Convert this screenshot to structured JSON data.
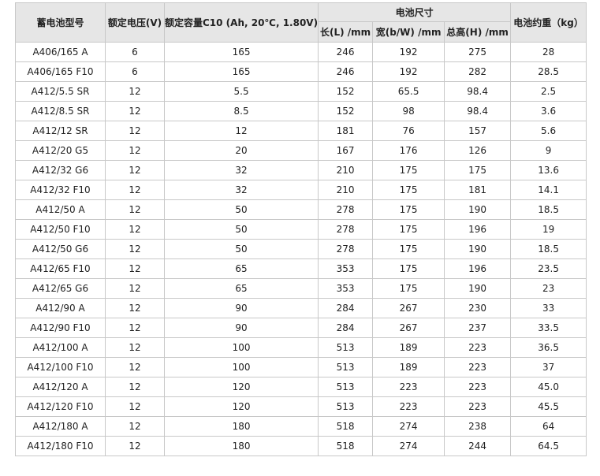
{
  "table": {
    "headers": {
      "model": "蓄电池型号",
      "voltage": "额定电压(V)",
      "capacity": "额定容量C10 (Ah, 20℃, 1.80V)",
      "dimensions": "电池尺寸",
      "length": "长(L) /mm",
      "width": "宽(b/W) /mm",
      "height": "总高(H) /mm",
      "weight": "电池约重（kg）"
    },
    "rows": [
      [
        "A406/165 A",
        "6",
        "165",
        "246",
        "192",
        "275",
        "28"
      ],
      [
        "A406/165 F10",
        "6",
        "165",
        "246",
        "192",
        "282",
        "28.5"
      ],
      [
        "A412/5.5 SR",
        "12",
        "5.5",
        "152",
        "65.5",
        "98.4",
        "2.5"
      ],
      [
        "A412/8.5 SR",
        "12",
        "8.5",
        "152",
        "98",
        "98.4",
        "3.6"
      ],
      [
        "A412/12 SR",
        "12",
        "12",
        "181",
        "76",
        "157",
        "5.6"
      ],
      [
        "A412/20 G5",
        "12",
        "20",
        "167",
        "176",
        "126",
        "9"
      ],
      [
        "A412/32 G6",
        "12",
        "32",
        "210",
        "175",
        "175",
        "13.6"
      ],
      [
        "A412/32 F10",
        "12",
        "32",
        "210",
        "175",
        "181",
        "14.1"
      ],
      [
        "A412/50 A",
        "12",
        "50",
        "278",
        "175",
        "190",
        "18.5"
      ],
      [
        "A412/50 F10",
        "12",
        "50",
        "278",
        "175",
        "196",
        "19"
      ],
      [
        "A412/50 G6",
        "12",
        "50",
        "278",
        "175",
        "190",
        "18.5"
      ],
      [
        "A412/65 F10",
        "12",
        "65",
        "353",
        "175",
        "196",
        "23.5"
      ],
      [
        "A412/65 G6",
        "12",
        "65",
        "353",
        "175",
        "190",
        "23"
      ],
      [
        "A412/90 A",
        "12",
        "90",
        "284",
        "267",
        "230",
        "33"
      ],
      [
        "A412/90 F10",
        "12",
        "90",
        "284",
        "267",
        "237",
        "33.5"
      ],
      [
        "A412/100 A",
        "12",
        "100",
        "513",
        "189",
        "223",
        "36.5"
      ],
      [
        "A412/100 F10",
        "12",
        "100",
        "513",
        "189",
        "223",
        "37"
      ],
      [
        "A412/120 A",
        "12",
        "120",
        "513",
        "223",
        "223",
        "45.0"
      ],
      [
        "A412/120 F10",
        "12",
        "120",
        "513",
        "223",
        "223",
        "45.5"
      ],
      [
        "A412/180 A",
        "12",
        "180",
        "518",
        "274",
        "238",
        "64"
      ],
      [
        "A412/180 F10",
        "12",
        "180",
        "518",
        "274",
        "244",
        "64.5"
      ]
    ]
  }
}
